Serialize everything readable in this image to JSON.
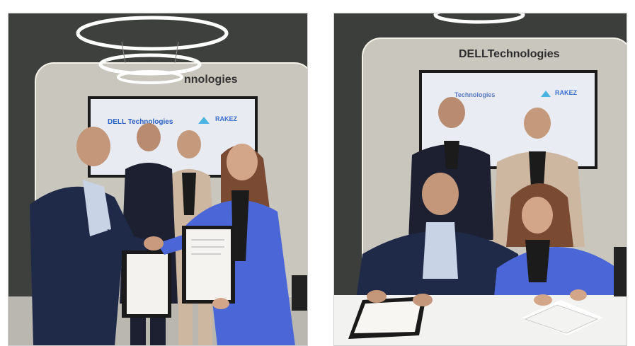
{
  "photos": [
    {
      "id": "handshake",
      "sign_text": "nnologies",
      "screen_left": "DELL Technologies",
      "screen_right": "RAKEZ"
    },
    {
      "id": "signing",
      "sign_text": "DELLTechnologies",
      "screen_left": "Technologies",
      "screen_right": "RAKEZ"
    }
  ],
  "colors": {
    "wall": "#3a3d3a",
    "sign_panel": "#c8c5bd",
    "screen": "#e9edf3",
    "suit_navy": "#1f2a48",
    "suit_blue": "#4b66d6",
    "beige_jacket": "#cdb7a0"
  }
}
